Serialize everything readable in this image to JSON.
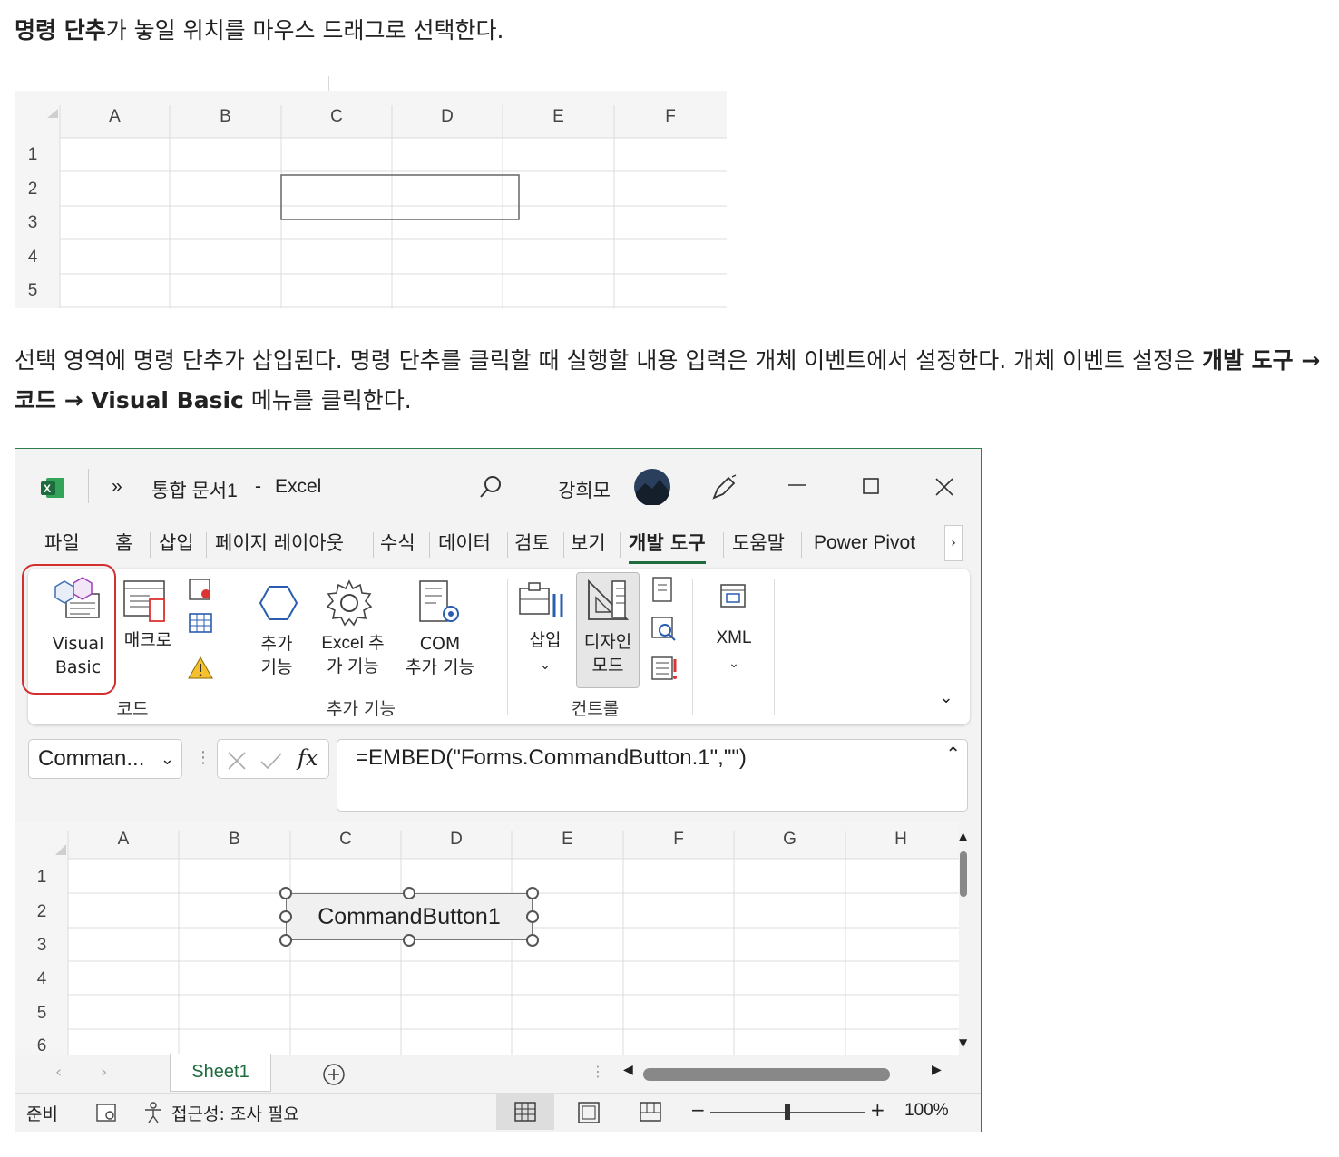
{
  "paragraph1": {
    "bold": "명령 단추",
    "rest": "가 놓일 위치를 마우스 드래그로 선택한다."
  },
  "paragraph2": {
    "text1": "선택 영역에 명령 단추가 삽입된다. 명령 단추를 클릭할 때 실행할 내용 입력은 개체 이벤트에서 설정한다. 개체 이벤트 설정은 ",
    "bold1": "개발 도구 → 코드 → Visual Basic",
    "text2": " 메뉴를 클릭한다."
  },
  "sheet_small": {
    "columns": [
      "A",
      "B",
      "C",
      "D",
      "E",
      "F"
    ],
    "rows": [
      "1",
      "2",
      "3",
      "4",
      "5"
    ]
  },
  "excel": {
    "title_arrow": "»",
    "doc_title": "통합 문서1",
    "title_dash": "-",
    "app_name": "Excel",
    "user_name": "강희모",
    "tabs": [
      "파일",
      "홈",
      "삽입",
      "페이지 레이아웃",
      "수식",
      "데이터",
      "검토",
      "보기",
      "개발 도구",
      "도움말",
      "Power Pivot"
    ],
    "ribbon": {
      "visual_basic": "Visual\nBasic",
      "macro": "매크로",
      "code_group": "코드",
      "addins": "추가\n기능",
      "excel_addins": "Excel 추\n가 기능",
      "com_addins": "COM\n추가 기능",
      "addins_group": "추가 기능",
      "insert": "삽입",
      "design_mode": "디자인\n모드",
      "controls_group": "컨트롤",
      "xml": "XML"
    },
    "name_box": "Comman...",
    "fx": "fx",
    "formula": "=EMBED(\"Forms.CommandButton.1\",\"\")",
    "columns": [
      "A",
      "B",
      "C",
      "D",
      "E",
      "F",
      "G",
      "H"
    ],
    "rows": [
      "1",
      "2",
      "3",
      "4",
      "5",
      "6"
    ],
    "command_button": "CommandButton1",
    "sheet_tab": "Sheet1",
    "status_ready": "준비",
    "status_accessibility": "접근성: 조사 필요",
    "zoom": "100%"
  }
}
